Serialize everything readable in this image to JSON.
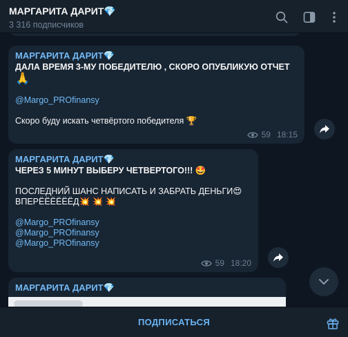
{
  "header": {
    "title": "МАРГАРИТА ДАРИТ💎",
    "subtitle": "3 316 подписчиков",
    "icons": [
      "search-icon",
      "sidebar-toggle-icon",
      "more-icon"
    ]
  },
  "messages": [
    {
      "author": "МАРГАРИТА ДАРИТ💎",
      "lines": [
        "ДАЛА ВРЕМЯ 3-МУ ПОБЕДИТЕЛЮ , СКОРО ОПУБЛИКУЮ ОТЧЕТ",
        "🙏",
        "",
        "@Margo_PROfinansy",
        "",
        "Скоро буду искать четвёртого победителя 🏆"
      ],
      "views": "59",
      "time": "18:15"
    },
    {
      "author": "МАРГАРИТА ДАРИТ💎",
      "lines": [
        "ЧЕРЕЗ 5 МИНУТ ВЫБЕРУ ЧЕТВЕРТОГО!!! 🤩",
        "",
        "ПОСЛЕДНИЙ ШАНС НАПИСАТЬ И ЗАБРАТЬ ДЕНЬГИ😍",
        "ВПЕРЁЁЁЁЁЁД💥 💥 💥",
        "",
        "@Margo_PROfinansy",
        "@Margo_PROfinansy",
        "@Margo_PROfinansy"
      ],
      "views": "59",
      "time": "18:20"
    },
    {
      "author": "МАРГАРИТА ДАРИТ💎"
    }
  ],
  "footer": {
    "subscribe_label": "ПОДПИСАТЬСЯ",
    "gift_icon": "gift-icon"
  },
  "colors": {
    "background": "#0e1621",
    "panel": "#17212b",
    "bubble": "#182533",
    "accent": "#6ab3f3"
  }
}
